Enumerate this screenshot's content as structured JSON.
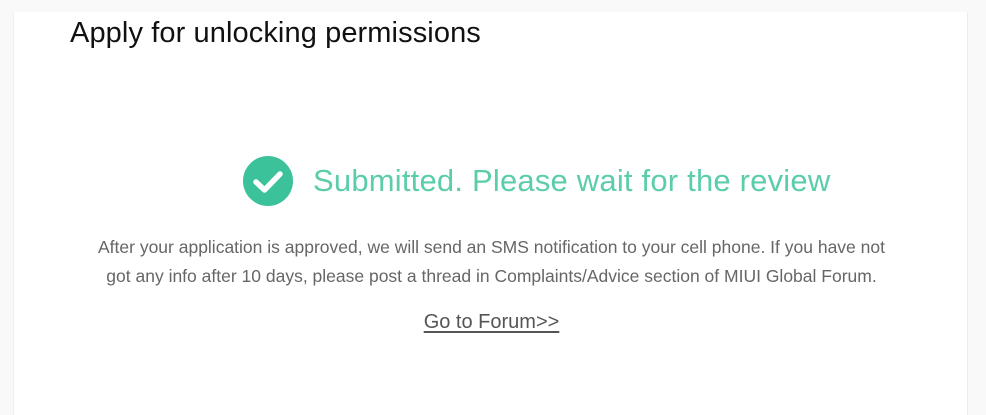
{
  "page": {
    "title": "Apply for unlocking permissions"
  },
  "status": {
    "icon": "check-circle-icon",
    "text": "Submitted. Please wait for the review",
    "color": "#5ccdaa"
  },
  "notice": {
    "line1": "After your application is approved, we will send an SMS notification to your cell phone. If you have not",
    "line2": "got any info after 10 days, please post a thread in Complaints/Advice section of MIUI Global Forum."
  },
  "forum_link": {
    "label": "Go to Forum>>"
  }
}
